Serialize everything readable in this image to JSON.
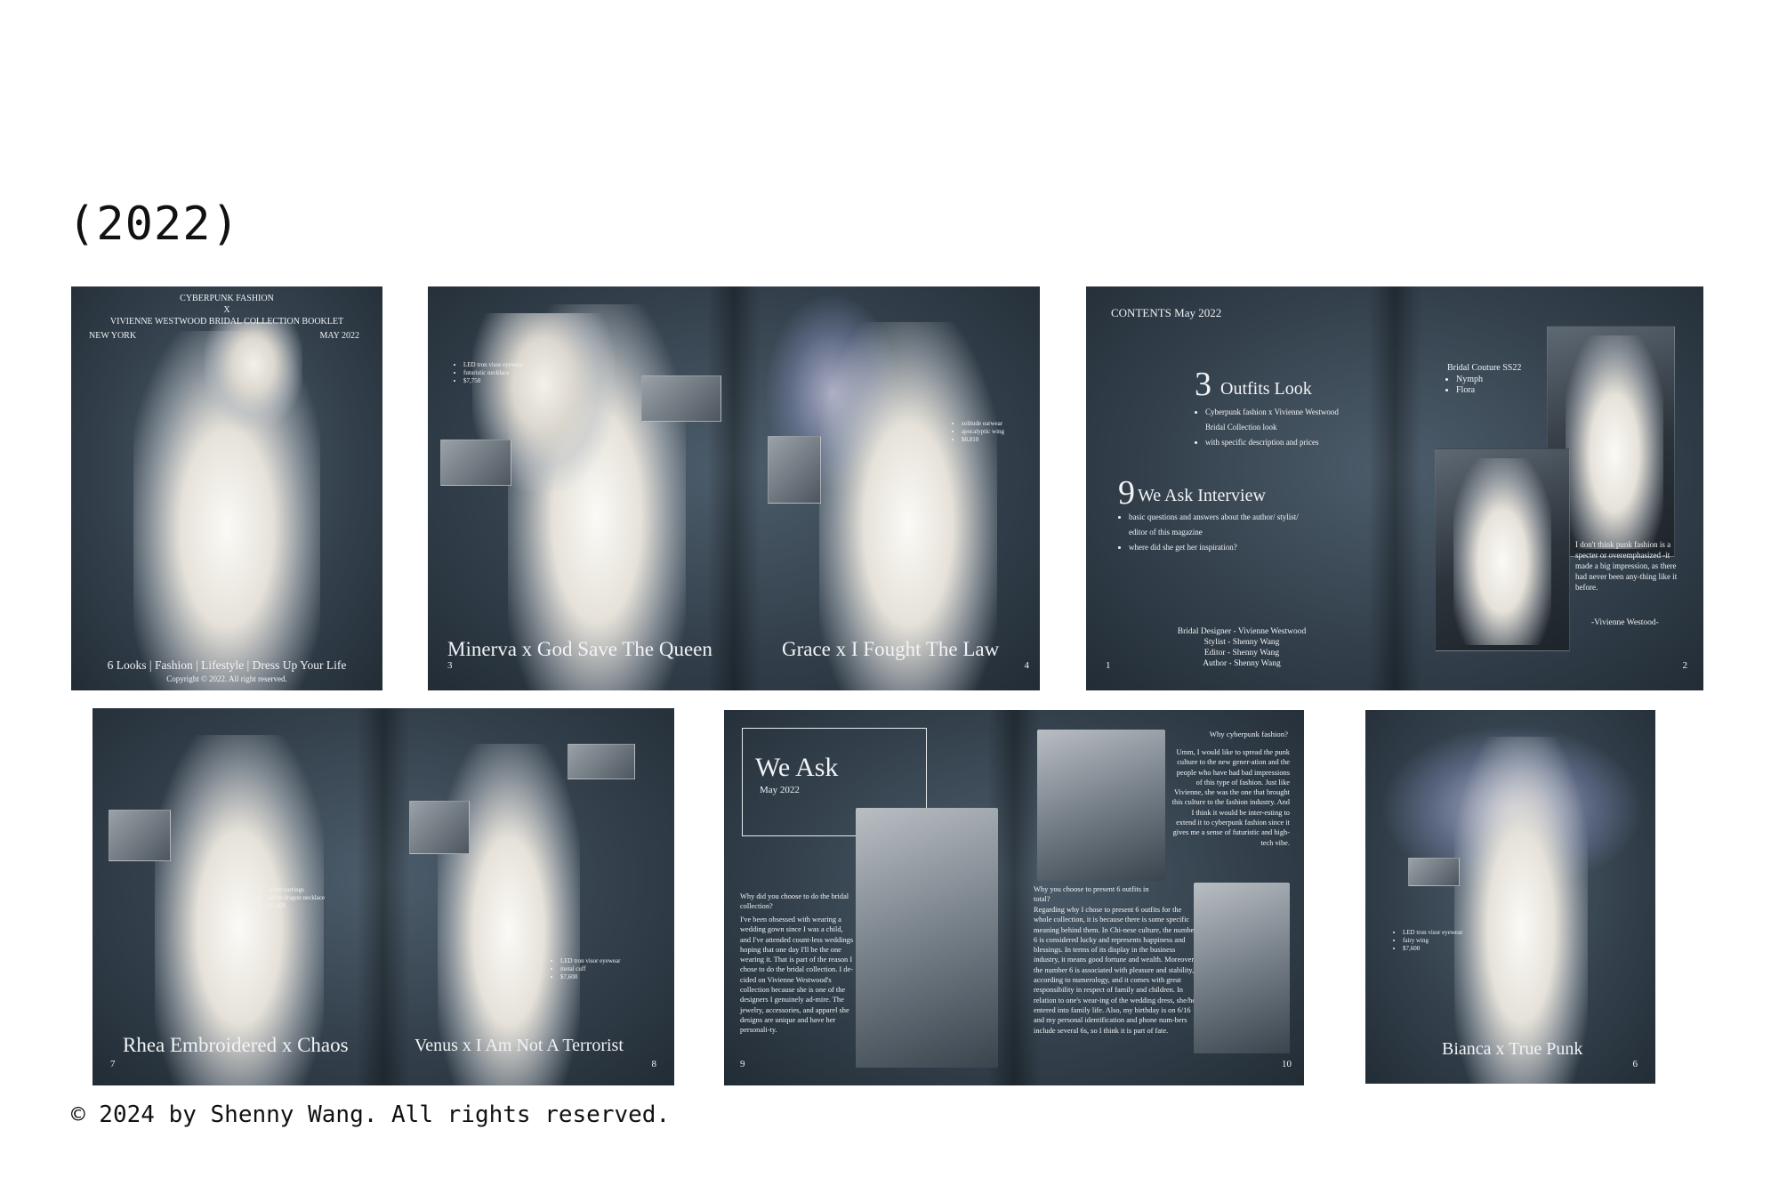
{
  "year": "(2022)",
  "footer": "© 2024 by Shenny Wang. All rights reserved.",
  "cover": {
    "line1": "CYBERPUNK FASHION",
    "line2": "X",
    "line3": "VIVIENNE WESTWOOD BRIDAL COLLECTION BOOKLET",
    "city": "NEW YORK",
    "date": "MAY 2022",
    "tagline": "6 Looks | Fashion | Lifestyle | Dress Up Your Life",
    "copyright": "Copyright © 2022. All right reserved."
  },
  "spread1": {
    "left_bullets": [
      "LED tron visor eyewear",
      "futuristic necklace",
      "$7,750"
    ],
    "left_title": "Minerva x God Save The Queen",
    "left_page": "3",
    "right_bullets": [
      "solitude earwear",
      "apocalyptic wing",
      "$8,810"
    ],
    "right_title": "Grace x I Fought The Law",
    "right_page": "4"
  },
  "contents": {
    "heading": "CONTENTS May 2022",
    "item1_num": "3",
    "item1_title": "Outfits Look",
    "item1_bullets": [
      "Cyberpunk fashion x Vivienne Westwood",
      "Bridal Collection look",
      "with specific description and prices"
    ],
    "item2_num": "9",
    "item2_title": "We Ask Interview",
    "item2_bullets": [
      "basic questions and answers about the author/ stylist/",
      "editor of this magazine",
      "where did she get her inspiration?"
    ],
    "credits": [
      "Bridal Designer - Vivienne Westwood",
      "Stylist - Shenny Wang",
      "Editor - Shenny Wang",
      "Author - Shenny Wang"
    ],
    "left_page": "1",
    "right_heading": "Bridal Couture SS22",
    "right_bullets": [
      "Nymph",
      "Flora"
    ],
    "quote": "I don't think punk fashion is a specter or overemphasized -it made a big impression, as there had never been any-thing like it before.",
    "quote_author": "-Vivienne Westood-",
    "right_page": "2"
  },
  "spread2": {
    "left_bullets": [
      "silver earrings",
      "silver dragon necklace",
      "$5,420"
    ],
    "left_title": "Rhea Embroidered x Chaos",
    "left_page": "7",
    "right_bullets": [
      "LED tron visor eyewear",
      "metal cuff",
      "$7,600"
    ],
    "right_title": "Venus x I Am Not A Terrorist",
    "right_page": "8"
  },
  "weask": {
    "title": "We Ask",
    "date": "May 2022",
    "q1": "Why did you choose to do the bridal collection?",
    "a1": "I've been obsessed with wearing a wedding gown since I was a child, and I've attended count-less weddings hoping that one day I'll be the one wearing it. That is part of the reason I chose to do the bridal collection. I de-cided on Vivienne Westwood's collection because she is one of the designers I genuinely ad-mire. The jewelry, accessories, and apparel she designs are unique and have her personali-ty.",
    "left_page": "9",
    "q2": "Why cyberpunk fashion?",
    "a2": "Umm, I would like to spread the punk culture to the new gener-ation and the people who have had bad impressions of this type of fashion. Just like Vivienne, she was the one that brought this culture to the fashion industry. And I think it would be inter-esting to extend it to cyberpunk fashion since it gives me a sense of futuristic and high-tech vibe.",
    "q3": "Why you choose to present 6 outfits in total?",
    "a3": "Regarding why I chose to present 6 outfits for the whole collection, it is because there is some specific meaning behind them. In Chi-nese culture, the number 6 is considered lucky and represents happiness and blessings. In terms of its display in the business industry, it means good fortune and wealth. Moreover, the number 6 is associated with pleasure and stability, according to numerology, and it comes with great responsibility in respect of family and children. In relation to one's wear-ing of the wedding dress, she/he entered into family life. Also, my birthday is on 6/16 and my personal identification and phone num-bers include several 6s, so I think it is part of fate.",
    "right_page": "10"
  },
  "bianca": {
    "bullets": [
      "LED tron visor eyewear",
      "fairy wing",
      "$7,600"
    ],
    "title": "Bianca x True Punk",
    "page": "6"
  }
}
